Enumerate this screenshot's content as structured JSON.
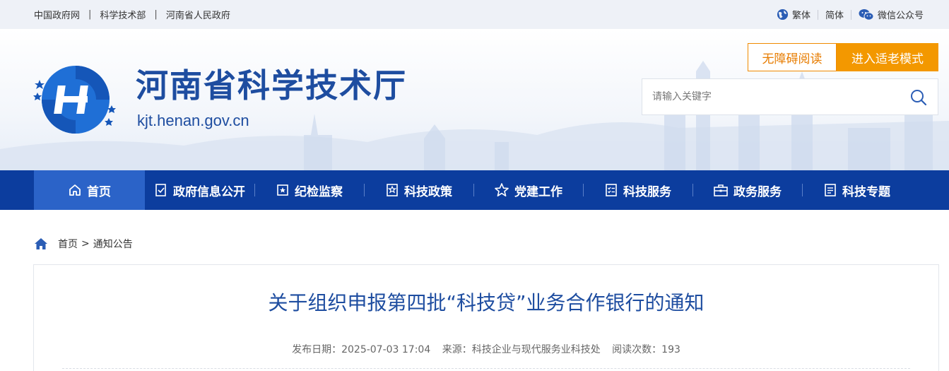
{
  "topbar": {
    "links": [
      "中国政府网",
      "科学技术部",
      "河南省人民政府"
    ],
    "separator": "|",
    "traditional": "繁体",
    "simplified": "简体",
    "wechat": "微信公众号"
  },
  "header": {
    "site_name": "河南省科学技术厅",
    "domain": "kjt.henan.gov.cn",
    "accessible_label": "无障碍阅读",
    "elder_label": "进入适老模式",
    "search_placeholder": "请输入关键字"
  },
  "nav": {
    "items": [
      "首页",
      "政府信息公开",
      "纪检监察",
      "科技政策",
      "党建工作",
      "科技服务",
      "政务服务",
      "科技专题"
    ]
  },
  "breadcrumb": {
    "home": "首页",
    "separator": ">",
    "current": "通知公告"
  },
  "article": {
    "title": "关于组织申报第四批“科技贷”业务合作银行的通知",
    "publish_date": "发布日期：2025-07-03 17:04",
    "source": "来源：科技企业与现代服务业科技处",
    "views": "阅读次数：193"
  },
  "colors": {
    "brand_blue": "#1e4da0",
    "nav_bg": "#0c3d9e",
    "nav_active": "#2b63c8",
    "accent_orange": "#f39800"
  }
}
